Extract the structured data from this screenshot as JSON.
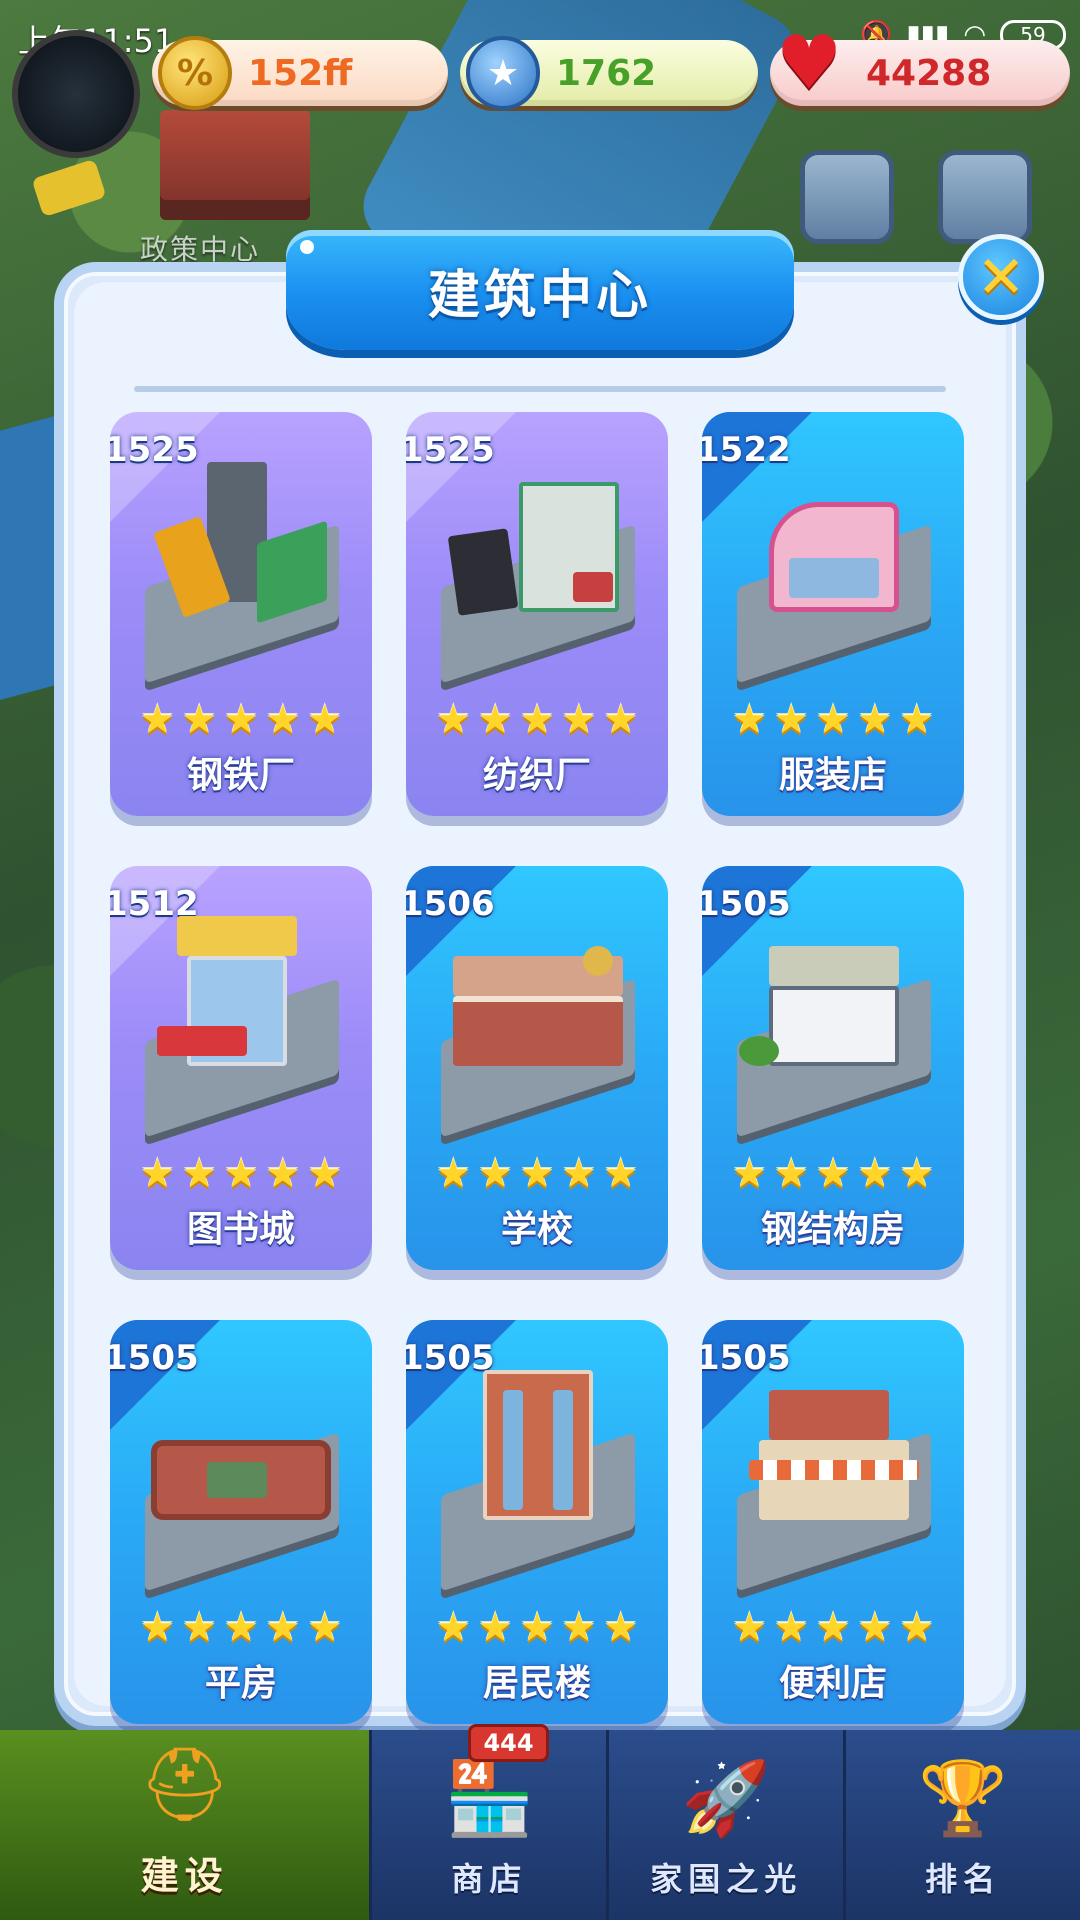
{
  "status_bar": {
    "time": "上午11:51",
    "battery": "59"
  },
  "resources": {
    "coin": "152ff",
    "star": "1762",
    "heart": "44288"
  },
  "map": {
    "label": "政策中心"
  },
  "panel": {
    "title": "建筑中心",
    "close_label": "✕"
  },
  "buildings": [
    {
      "score": "1525",
      "name": "钢铁厂",
      "stars": 5,
      "theme": "purple"
    },
    {
      "score": "1525",
      "name": "纺织厂",
      "stars": 5,
      "theme": "purple"
    },
    {
      "score": "1522",
      "name": "服装店",
      "stars": 5,
      "theme": "blue"
    },
    {
      "score": "1512",
      "name": "图书城",
      "stars": 5,
      "theme": "purple"
    },
    {
      "score": "1506",
      "name": "学校",
      "stars": 5,
      "theme": "blue"
    },
    {
      "score": "1505",
      "name": "钢结构房",
      "stars": 5,
      "theme": "blue"
    },
    {
      "score": "1505",
      "name": "平房",
      "stars": 5,
      "theme": "blue"
    },
    {
      "score": "1505",
      "name": "居民楼",
      "stars": 5,
      "theme": "blue"
    },
    {
      "score": "1505",
      "name": "便利店",
      "stars": 5,
      "theme": "blue"
    }
  ],
  "bottom_nav": {
    "tabs": [
      {
        "label": "建设",
        "icon": "hard-hat-icon",
        "active": true
      },
      {
        "label": "商店",
        "icon": "shop-icon",
        "active": false,
        "badge": "444"
      },
      {
        "label": "家国之光",
        "icon": "rocket-icon",
        "active": false
      },
      {
        "label": "排名",
        "icon": "podium-icon",
        "active": false
      }
    ]
  },
  "colors": {
    "accent_blue": "#1a8ff0",
    "card_purple": "#9c8cf8",
    "card_blue": "#2aa9f5",
    "star_gold": "#ffd52a"
  }
}
